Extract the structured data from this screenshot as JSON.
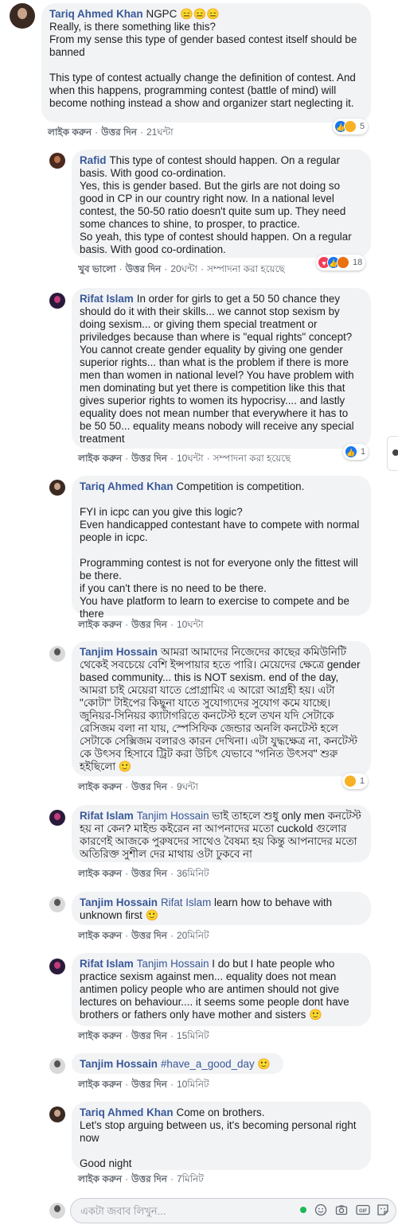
{
  "comments": [
    {
      "author": "Tariq Ahmed Khan",
      "paragraphs": [
        "NGPC 😑😑😑\nReally, is there something like this?\nFrom my sense this type of gender based contest itself should be banned",
        "This type of contest actually change the definition of contest. And when this happens, programming contest (battle of mind) will become nothing instead a show and organizer start neglecting it."
      ],
      "actions": {
        "like": "লাইক করুন",
        "reply": "উত্তর দিন",
        "time": "21ঘন্টা"
      },
      "reaction_count": "5"
    },
    {
      "author": "Rafid",
      "paragraphs": [
        "This type of contest should happen. On a regular basis. With good co-ordination.\nYes, this is gender based. But the girls are not doing so good in CP in our country right now. In a national level contest, the 50-50 ratio doesn't quite sum up. They need some chances to shine, to prosper, to practice.\nSo yeah, this type of contest should happen. On a regular basis. With good co-ordination."
      ],
      "actions": {
        "like": "খুব ভালো",
        "reply": "উত্তর দিন",
        "time": "20ঘন্টা",
        "edited": "সম্পাদনা করা হয়েছে"
      },
      "reaction_count": "18"
    },
    {
      "author": "Rifat Islam",
      "paragraphs": [
        "In order for girls to get a 50 50 chance they should do it with their skills... we cannot stop sexism by doing sexism... or giving them special treatment or priviledges because than where is \"equal rights\" concept? You cannot create gender equality by giving one gender superior rights... than what is the problem if there is more men than women in national level? You have problem with men dominating but yet there is competition like this that gives superior rights to women its hypocrisy.... and lastly equality does not mean number that everywhere it has to be 50 50... equality means nobody will receive any special treatment"
      ],
      "actions": {
        "like": "লাইক করুন",
        "reply": "উত্তর দিন",
        "time": "10ঘন্টা",
        "edited": "সম্পাদনা করা হয়েছে"
      },
      "reaction_count": "1"
    },
    {
      "author": "Tariq Ahmed Khan",
      "paragraphs": [
        "Competition is competition.",
        "FYI in icpc can you give this logic?\nEven handicapped contestant have to compete with normal people in icpc.",
        "Programming contest is not for everyone only the fittest will be there.\nif you can't there is no need to be there.\nYou have platform to learn to exercise to compete and be there"
      ],
      "actions": {
        "like": "লাইক করুন",
        "reply": "উত্তর দিন",
        "time": "10ঘন্টা"
      }
    },
    {
      "author": "Tanjim Hossain",
      "paragraphs": [
        "আমরা আমাদের নিজেদের কাছের কমিউনিটি থেকেই সবচেয়ে বেশি ইন্সপায়ার হতে পারি। মেয়েদের ক্ষেত্রে gender based community... this is NOT sexism. end of the day, আমরা চাই মেয়েরা যাতে প্রোগ্রামিং এ আরো আগ্রহী হয়। এটা \"কোটা\" টাইপের কিছুনা যাতে সুযোগ্যদের সুযোগ কমে যাচ্ছে। জুনিয়র-সিনিয়র ক্যাটাগরিতে কনটেস্ট হলে তখন যদি সেটাকে রেসিজম বলা না যায়, স্পেসিফিক জেন্ডার অনলি কনটেস্ট হলে সেটাকে সেক্সিজম বলারও কারন দেখিনা। এটা যুদ্ধক্ষেত্র না, কনটেস্ট কে উৎসব হিসাবে ট্রিট করা উচিৎ যেভাবে \"গনিত উৎসব\" শুরু হইছিলো 🙂"
      ],
      "actions": {
        "like": "লাইক করুন",
        "reply": "উত্তর দিন",
        "time": "9ঘন্টা"
      },
      "reaction_count": "1"
    },
    {
      "author": "Rifat Islam",
      "mention": "Tanjim Hossain",
      "paragraphs": [
        "ভাই তাহলে শুধু only men কনটেস্ট হয় না কেন? মাইন্ড কইরেন না আপনাদের মতো cuckold গুলোর কারণেই আজকে পুরুষদের সাথেও বৈষম্য হয় কিন্তু আপনাদের মতো অতিরিক্ত সুশীল দের মাথায় ওটা ঢুকবে না"
      ],
      "actions": {
        "like": "লাইক করুন",
        "reply": "উত্তর দিন",
        "time": "36মিনিট"
      }
    },
    {
      "author": "Tanjim Hossain",
      "mention": "Rifat Islam",
      "paragraphs": [
        "learn how to behave with unknown first 🙂"
      ],
      "actions": {
        "like": "লাইক করুন",
        "reply": "উত্তর দিন",
        "time": "20মিনিট"
      }
    },
    {
      "author": "Rifat Islam",
      "mention": "Tanjim Hossain",
      "paragraphs": [
        "I do but I hate people who practice sexism against men... equality does not mean antimen policy people who are antimen should not give lectures on behaviour.... it seems some people dont have brothers or fathers only have mother and sisters 🙂"
      ],
      "actions": {
        "like": "লাইক করুন",
        "reply": "উত্তর দিন",
        "time": "15মিনিট"
      }
    },
    {
      "author": "Tanjim Hossain",
      "mention": "#have_a_good_day",
      "paragraphs": [
        "🙂"
      ],
      "actions": {
        "like": "লাইক করুন",
        "reply": "উত্তর দিন",
        "time": "10মিনিট"
      }
    },
    {
      "author": "Tariq Ahmed Khan",
      "paragraphs": [
        "Come on brothers.\nLet's stop arguing between us, it's becoming personal right now",
        "Good night"
      ],
      "actions": {
        "like": "লাইক করুন",
        "reply": "উত্তর দিন",
        "time": "7মিনিট"
      }
    }
  ],
  "reply_box": {
    "placeholder": "একটা জবাব লিখুন..."
  },
  "icons": [
    "smile-icon",
    "camera-icon",
    "gif-icon",
    "sticker-icon"
  ],
  "colors": {
    "link": "#385898",
    "bubble": "#f2f3f5",
    "like_blue": "#1877f2",
    "love_red": "#f33e58"
  }
}
